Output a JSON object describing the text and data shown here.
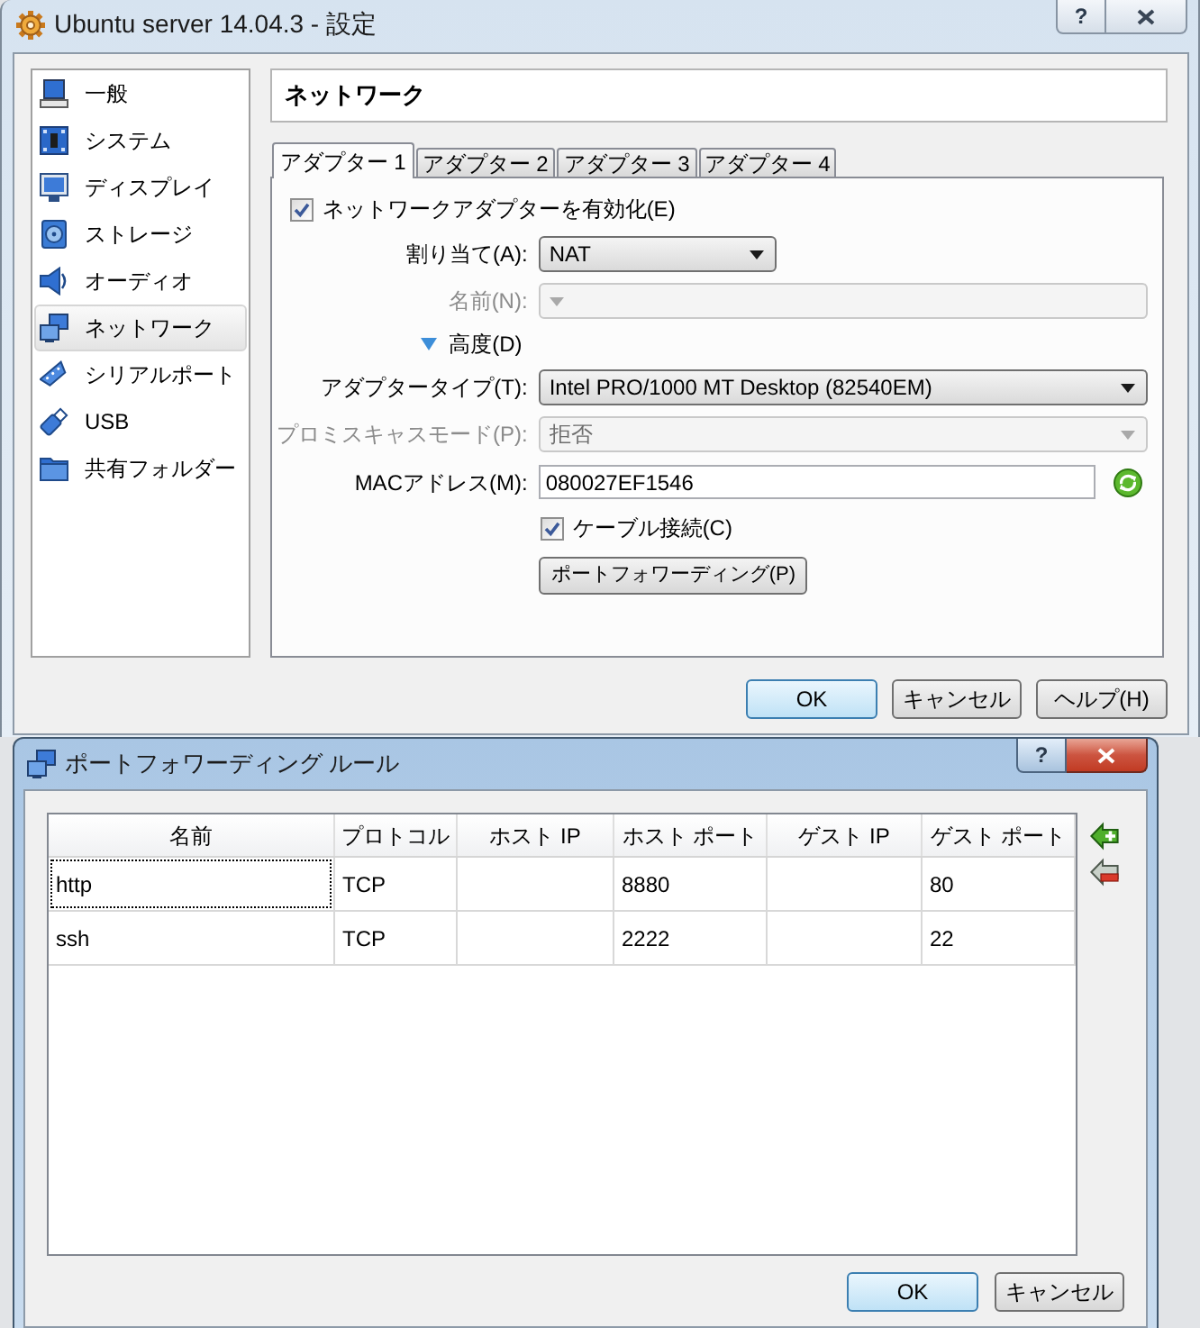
{
  "window": {
    "title": "Ubuntu server 14.04.3 - 設定",
    "help_button": "?",
    "active": false
  },
  "sidebar": {
    "items": [
      {
        "label": "一般",
        "selected": false
      },
      {
        "label": "システム",
        "selected": false
      },
      {
        "label": "ディスプレイ",
        "selected": false
      },
      {
        "label": "ストレージ",
        "selected": false
      },
      {
        "label": "オーディオ",
        "selected": false
      },
      {
        "label": "ネットワーク",
        "selected": true
      },
      {
        "label": "シリアルポート",
        "selected": false
      },
      {
        "label": "USB",
        "selected": false
      },
      {
        "label": "共有フォルダー",
        "selected": false
      }
    ]
  },
  "section": {
    "title": "ネットワーク"
  },
  "tabs": [
    {
      "label": "アダプター 1",
      "selected": true
    },
    {
      "label": "アダプター 2",
      "selected": false
    },
    {
      "label": "アダプター 3",
      "selected": false
    },
    {
      "label": "アダプター 4",
      "selected": false
    }
  ],
  "adapter": {
    "enable": {
      "label": "ネットワークアダプターを有効化(E)",
      "checked": true
    },
    "fields": [
      {
        "kind": "dropdown",
        "label": "割り当て(A):",
        "value": "NAT",
        "disabled": false
      },
      {
        "kind": "dropdown",
        "label": "名前(N):",
        "disabled": true
      },
      {
        "kind": "toggle",
        "label": "高度(D)",
        "expanded": true
      },
      {
        "kind": "dropdown",
        "label": "アダプタータイプ(T):",
        "value": "Intel PRO/1000 MT Desktop (82540EM)",
        "disabled": false
      },
      {
        "kind": "dropdown",
        "label": "プロミスキャスモード(P):",
        "value": "拒否",
        "disabled": true
      },
      {
        "kind": "text",
        "label": "MACアドレス(M):",
        "value": "080027EF1546"
      },
      {
        "kind": "checkbox",
        "label": "ケーブル接続(C)",
        "checked": true
      },
      {
        "kind": "button",
        "label": "ポートフォワーディング(P)"
      }
    ]
  },
  "buttons": [
    {
      "label": "OK",
      "default": true
    },
    {
      "label": "キャンセル",
      "default": false
    },
    {
      "label": "ヘルプ(H)",
      "default": false
    }
  ],
  "dialog": {
    "title": "ポートフォワーディング ルール",
    "help_button": "?",
    "active": true,
    "table": {
      "columns": [
        "名前",
        "プロトコル",
        "ホスト IP",
        "ホスト ポート",
        "ゲスト IP",
        "ゲスト ポート"
      ],
      "rows": [
        {
          "name": "http",
          "protocol": "TCP",
          "host_port": "8880",
          "guest_port": "80",
          "focused": true
        },
        {
          "name": "ssh",
          "protocol": "TCP",
          "host_port": "2222",
          "guest_port": "22",
          "focused": false
        }
      ]
    },
    "buttons": [
      {
        "label": "OK",
        "default": true
      },
      {
        "label": "キャンセル",
        "default": false
      }
    ]
  }
}
